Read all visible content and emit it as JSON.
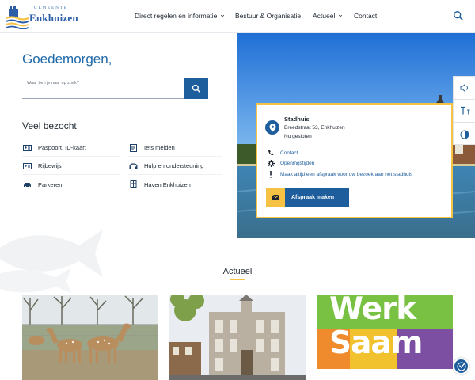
{
  "header": {
    "logo_top": "GEMEENTE",
    "logo_name": "Enkhuizen",
    "nav": [
      {
        "label": "Direct regelen en informatie",
        "has_dropdown": true
      },
      {
        "label": "Bestuur & Organisatie",
        "has_dropdown": false
      },
      {
        "label": "Actueel",
        "has_dropdown": true
      },
      {
        "label": "Contact",
        "has_dropdown": false
      }
    ],
    "search_icon": "search-icon"
  },
  "hero": {
    "greeting": "Goedemorgen,",
    "search_placeholder": "Waar ben je naar op zoek?"
  },
  "veel_bezocht": {
    "title": "Veel bezocht",
    "items": [
      {
        "label": "Paspoort, ID-kaart",
        "icon": "id-card-icon"
      },
      {
        "label": "Iets melden",
        "icon": "report-icon"
      },
      {
        "label": "Rijbewijs",
        "icon": "license-icon"
      },
      {
        "label": "Hulp en ondersteuning",
        "icon": "support-icon"
      },
      {
        "label": "Parkeren",
        "icon": "car-icon"
      },
      {
        "label": "Haven Enkhuizen",
        "icon": "harbor-icon"
      }
    ]
  },
  "card": {
    "name": "Stadhuis",
    "address": "Breedstraat 53, Enkhuizen",
    "status": "Nu gesloten",
    "links": [
      {
        "label": "Contact",
        "icon": "phone-icon"
      },
      {
        "label": "Openingstijden",
        "icon": "gear-icon"
      },
      {
        "label": "Maak altijd een afspraak voor uw bezoek aan het stadhuis",
        "icon": "exclamation-icon"
      }
    ],
    "button": "Afspraak maken"
  },
  "a11y_toolbar": [
    "speaker-icon",
    "text-size-icon",
    "contrast-icon"
  ],
  "actueel": {
    "title": "Actueel",
    "news_images": [
      "deer-photo",
      "town-hall-photo",
      "werk-saam-graphic"
    ],
    "werk_saam": [
      "Werk",
      "Saam"
    ]
  },
  "colors": {
    "primary": "#1e5e9c",
    "accent": "#f6c243",
    "greeting": "#1e68a8"
  }
}
